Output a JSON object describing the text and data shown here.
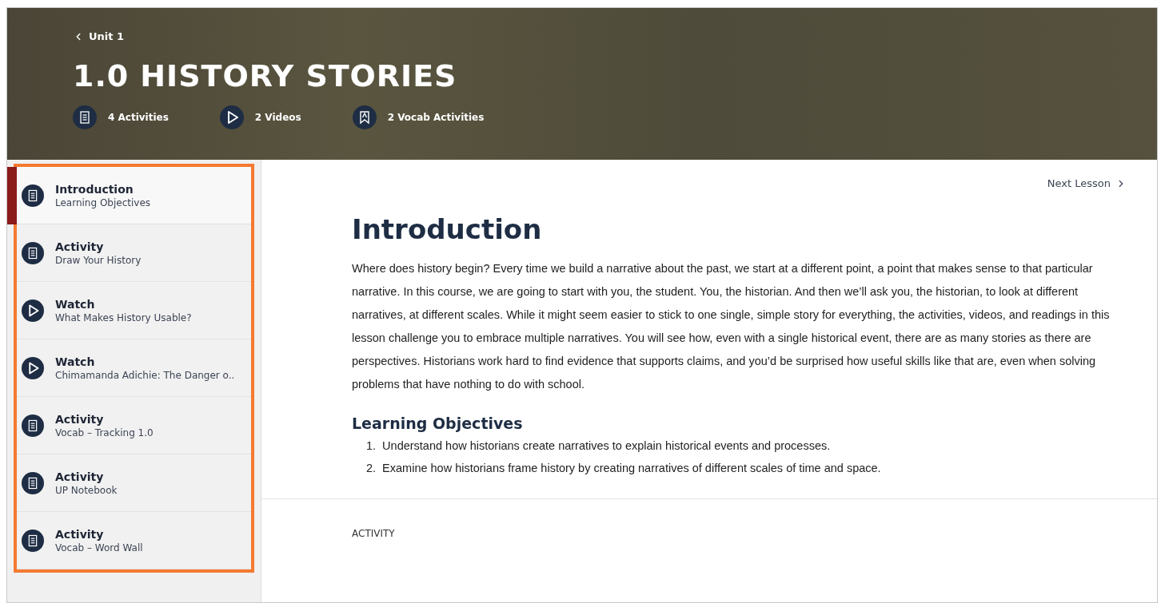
{
  "header": {
    "back_link": "Unit 1",
    "title": "1.0 HISTORY STORIES",
    "stats": [
      {
        "kind": "document",
        "label": "4 Activities"
      },
      {
        "kind": "play",
        "label": "2 Videos"
      },
      {
        "kind": "vocab",
        "label": "2 Vocab Activities"
      }
    ]
  },
  "sidebar": {
    "items": [
      {
        "kind": "document",
        "title": "Introduction",
        "subtitle": "Learning Objectives",
        "selected": true
      },
      {
        "kind": "document",
        "title": "Activity",
        "subtitle": "Draw Your History",
        "selected": false
      },
      {
        "kind": "play",
        "title": "Watch",
        "subtitle": "What Makes History Usable?",
        "selected": false
      },
      {
        "kind": "play",
        "title": "Watch",
        "subtitle": "Chimamanda Adichie: The Danger o..",
        "selected": false
      },
      {
        "kind": "document",
        "title": "Activity",
        "subtitle": "Vocab – Tracking 1.0",
        "selected": false
      },
      {
        "kind": "document",
        "title": "Activity",
        "subtitle": "UP Notebook",
        "selected": false
      },
      {
        "kind": "document",
        "title": "Activity",
        "subtitle": "Vocab – Word Wall",
        "selected": false
      }
    ]
  },
  "main": {
    "next_link": "Next Lesson",
    "heading": "Introduction",
    "paragraph": "Where does history begin? Every time we build a narrative about the past, we start at a different point, a point that makes sense to that particular narrative. In this course, we are going to start with you, the student. You, the historian. And then we’ll ask you, the historian, to look at different narratives, at different scales. While it might seem easier to stick to one single, simple story for everything, the activities, videos, and readings in this lesson challenge you to embrace multiple narratives. You will see how, even with a single historical event, there are as many stories as there are perspectives. Historians work hard to find evidence that supports claims, and you’d be surprised how useful skills like that are, even when solving problems that have nothing to do with school.",
    "subheading": "Learning Objectives",
    "objectives": [
      {
        "number": "1.",
        "text": "Understand how historians create narratives to explain historical events and processes."
      },
      {
        "number": "2.",
        "text": "Examine how historians frame history by creating narratives of different scales of time and space."
      }
    ],
    "next_section_label": "ACTIVITY"
  }
}
